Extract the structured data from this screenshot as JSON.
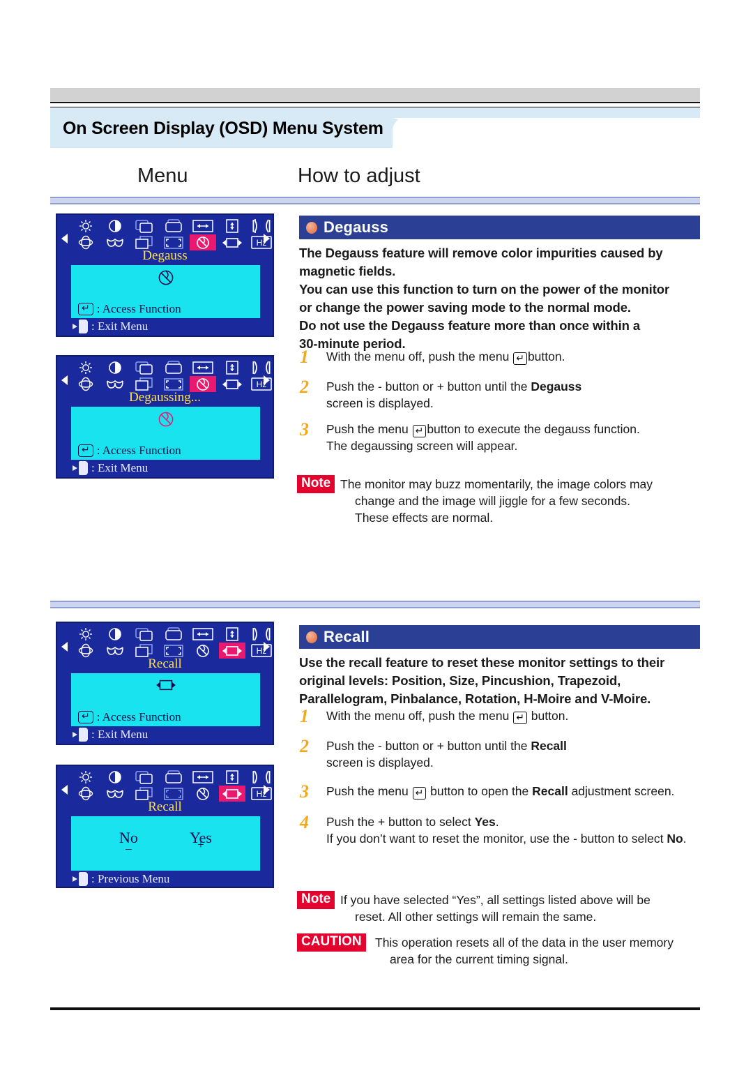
{
  "header": {
    "title": "On Screen Display (OSD) Menu System",
    "column_menu": "Menu",
    "column_howto": "How to adjust"
  },
  "osd_icons": {
    "row1": [
      "brightness-icon",
      "contrast-icon",
      "h-position-icon",
      "v-position-icon",
      "h-size-icon",
      "v-size-icon",
      "pincushion-icon"
    ],
    "row2": [
      "rotation-icon",
      "pinbalance-icon",
      "parallelogram-icon",
      "trapezoid-icon",
      "degauss-icon",
      "recall-icon",
      "hz-icon"
    ],
    "hz_label": "Hz"
  },
  "sections": [
    {
      "id": "degauss",
      "header_label": "Degauss",
      "header_color": "#2b4094",
      "bullet_color": "#ec8f6a",
      "description": [
        "The Degauss feature will remove color impurities caused by",
        "magnetic fields.",
        "You can use this function to turn on the power of the monitor",
        "or change the power saving mode to the normal mode.",
        "Do not use the Degauss feature more than once within a",
        "30-minute period."
      ],
      "steps": [
        {
          "num": "1",
          "lines": [
            "With the menu off, push the menu |ENTER|button."
          ]
        },
        {
          "num": "2",
          "lines": [
            "Push the - button or  + button until the **Degauss**",
            "screen is displayed."
          ]
        },
        {
          "num": "3",
          "lines": [
            "Push the menu |ENTER|button to execute the degauss function.",
            "The degaussing screen will appear."
          ]
        }
      ],
      "notes": [
        {
          "badge": "Note",
          "badge_color": "#e4032e",
          "lines": [
            "The monitor may buzz momentarily, the image colors may",
            "change and the image will jiggle for a few seconds.",
            "These effects are normal."
          ]
        }
      ],
      "osd": [
        {
          "title": "Degauss",
          "selected_icon": "degauss-icon",
          "screen_icon": "degauss-icon",
          "access_label": ": Access Function",
          "exit_label": ": Exit Menu",
          "show_access": true,
          "show_yesno": false
        },
        {
          "title": "Degaussing...",
          "selected_icon": "degauss-icon",
          "screen_icon": "degauss-icon-pink",
          "access_label": ": Access Function",
          "exit_label": ": Exit Menu",
          "show_access": true,
          "show_yesno": false
        }
      ]
    },
    {
      "id": "recall",
      "header_label": "Recall",
      "header_color": "#2b4094",
      "bullet_color": "#ec8f6a",
      "description": [
        "Use the recall feature to reset these monitor settings to their",
        "original levels: Position, Size, Pincushion, Trapezoid,",
        "Parallelogram, Pinbalance, Rotation, H-Moire and V-Moire."
      ],
      "steps": [
        {
          "num": "1",
          "lines": [
            "With the menu off, push the menu |ENTER| button."
          ]
        },
        {
          "num": "2",
          "lines": [
            "Push the - button or  + button until the **Recall**",
            "screen is displayed."
          ]
        },
        {
          "num": "3",
          "lines": [
            "Push the menu |ENTER| button to open the **Recall** adjustment screen."
          ]
        },
        {
          "num": "4",
          "lines": [
            "Push the + button to select **Yes**.",
            "If you don’t want to reset the monitor, use the - button to select **No**."
          ]
        }
      ],
      "notes": [
        {
          "badge": "Note",
          "badge_color": "#e4032e",
          "lines": [
            "If you have selected “Yes”, all settings listed above will be",
            "reset. All other settings will remain the same."
          ]
        },
        {
          "badge": "CAUTION",
          "badge_color": "#e4032e",
          "lines": [
            "This operation resets all of the data in the user memory",
            "area for the current timing signal."
          ]
        }
      ],
      "osd": [
        {
          "title": "Recall",
          "selected_icon": "recall-icon",
          "screen_icon": "recall-icon",
          "access_label": ": Access Function",
          "exit_label": ": Exit Menu",
          "show_access": true,
          "show_yesno": false
        },
        {
          "title": "Recall",
          "selected_icon": "recall-icon",
          "screen_icon": "",
          "access_label": "",
          "exit_label": ": Previous Menu",
          "show_access": false,
          "show_yesno": true,
          "no_label": "No",
          "no_sign": "_",
          "yes_label": "Yes",
          "yes_sign": "+"
        }
      ]
    }
  ]
}
